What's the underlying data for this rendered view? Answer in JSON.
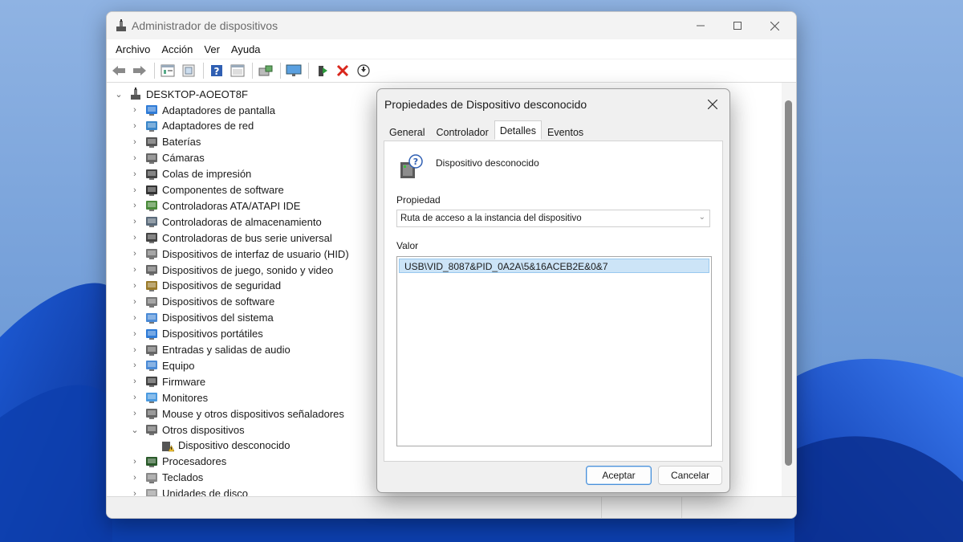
{
  "window": {
    "title": "Administrador de dispositivos",
    "menu": [
      "Archivo",
      "Acción",
      "Ver",
      "Ayuda"
    ],
    "toolbar_icons": [
      "back-arrow-icon",
      "forward-arrow-icon",
      "properties-icon",
      "update-driver-icon",
      "help-icon",
      "view-icon",
      "scan-hardware-icon",
      "monitor-icon",
      "add-driver-icon",
      "uninstall-x-icon",
      "disable-device-icon"
    ]
  },
  "tree": {
    "root": "DESKTOP-AOEOT8F",
    "categories": [
      "Adaptadores de pantalla",
      "Adaptadores de red",
      "Baterías",
      "Cámaras",
      "Colas de impresión",
      "Componentes de software",
      "Controladoras ATA/ATAPI IDE",
      "Controladoras de almacenamiento",
      "Controladoras de bus serie universal",
      "Dispositivos de interfaz de usuario (HID)",
      "Dispositivos de juego, sonido y video",
      "Dispositivos de seguridad",
      "Dispositivos de software",
      "Dispositivos del sistema",
      "Dispositivos portátiles",
      "Entradas y salidas de audio",
      "Equipo",
      "Firmware",
      "Monitores",
      "Mouse y otros dispositivos señaladores",
      "Otros dispositivos"
    ],
    "child_of_otros": "Dispositivo desconocido",
    "after": [
      "Procesadores",
      "Teclados",
      "Unidades de disco"
    ]
  },
  "dialog": {
    "title": "Propiedades de Dispositivo desconocido",
    "tabs": [
      "General",
      "Controlador",
      "Detalles",
      "Eventos"
    ],
    "active_tab": "Detalles",
    "device_name": "Dispositivo desconocido",
    "property_label": "Propiedad",
    "property_value": "Ruta de acceso a la instancia del dispositivo",
    "value_label": "Valor",
    "value_text": "USB\\VID_8087&PID_0A2A\\5&16ACEB2E&0&7",
    "ok_label": "Aceptar",
    "cancel_label": "Cancelar"
  },
  "colors": {
    "accent": "#4a90d9",
    "selection": "#cce4f7",
    "wallpaper": "#6f9fd8"
  }
}
